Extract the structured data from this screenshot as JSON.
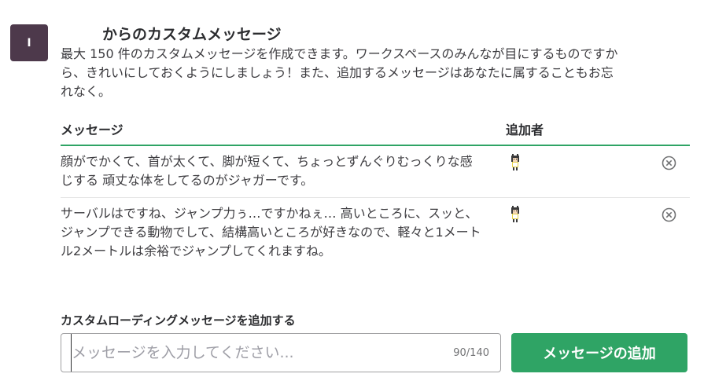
{
  "team_icon": {
    "letter": "I"
  },
  "title": "からのカスタムメッセージ",
  "description": "最大 150 件のカスタムメッセージを作成できます。ワークスペースのみんなが目にするものですから、きれいにしておくようにしましょう！また、追加するメッセージはあなたに属することもお忘れなく。",
  "table": {
    "columns": {
      "message": "メッセージ",
      "adder": "追加者"
    },
    "rows": [
      {
        "message": "顔がでかくて、首が太くて、脚が短くて、ちょっとずんぐりむっくりな感じする 頑丈な体をしてるのがジャガーです。"
      },
      {
        "message": "サーバルはですね、ジャンプ力ぅ…ですかねぇ… 高いところに、スッと、ジャンプできる動物でして、結構高いところが好きなので、軽々と1メートル2メートルは余裕でジャンプしてくれますね。"
      }
    ]
  },
  "add_form": {
    "label": "カスタムローディングメッセージを追加する",
    "placeholder": "メッセージを入力してください...",
    "value": "",
    "char_count": "90/140",
    "button_label": "メッセージの追加"
  },
  "colors": {
    "accent_green": "#2fa465",
    "team_icon_bg": "#4d394b"
  }
}
